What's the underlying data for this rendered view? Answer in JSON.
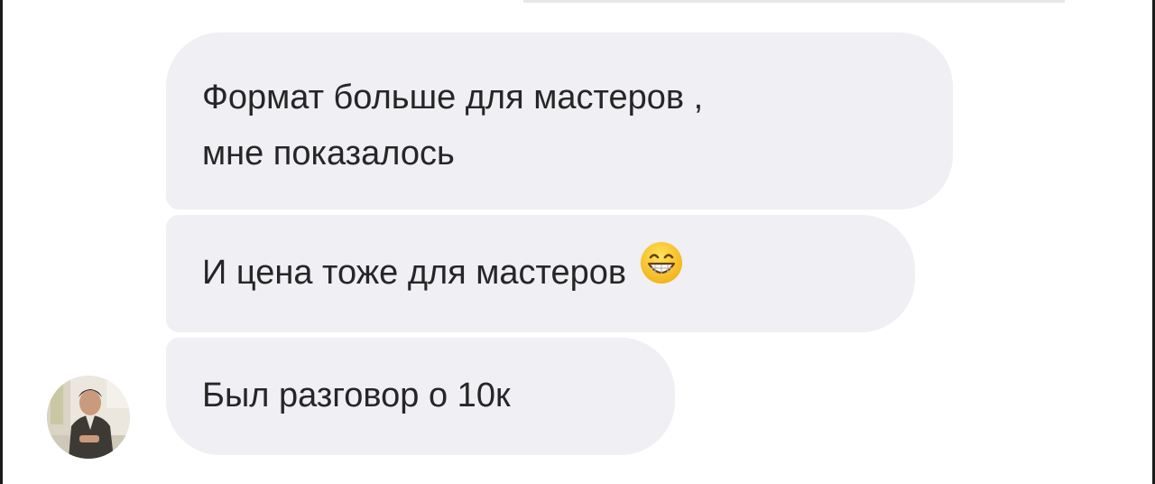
{
  "thread": {
    "messages": [
      {
        "lines": [
          "Формат больше для мастеров ,",
          "мне показалось"
        ]
      },
      {
        "lines": [
          "И цена тоже для мастеров"
        ],
        "emoji": "grinning-face-with-smiling-eyes-icon"
      },
      {
        "lines": [
          "Был разговор о 10к"
        ]
      }
    ]
  },
  "colors": {
    "bubble_bg": "#efeff4",
    "text": "#262626"
  }
}
